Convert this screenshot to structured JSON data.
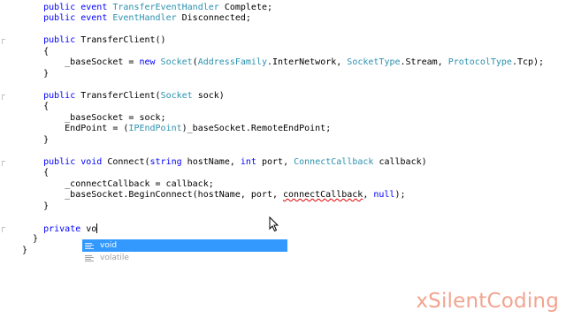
{
  "editor": {
    "lines": [
      [
        {
          "t": "    "
        },
        {
          "t": "public event ",
          "c": "kw"
        },
        {
          "t": "TransferEventHandler",
          "c": "ty"
        },
        {
          "t": " Complete;"
        }
      ],
      [
        {
          "t": "    "
        },
        {
          "t": "public event ",
          "c": "kw"
        },
        {
          "t": "EventHandler",
          "c": "ty"
        },
        {
          "t": " Disconnected;"
        }
      ],
      [
        {
          "t": ""
        }
      ],
      [
        {
          "t": "    "
        },
        {
          "t": "public ",
          "c": "kw"
        },
        {
          "t": "TransferClient()"
        }
      ],
      [
        {
          "t": "    {"
        }
      ],
      [
        {
          "t": "        _baseSocket = "
        },
        {
          "t": "new ",
          "c": "kw"
        },
        {
          "t": "Socket",
          "c": "ty"
        },
        {
          "t": "("
        },
        {
          "t": "AddressFamily",
          "c": "ty"
        },
        {
          "t": ".InterNetwork, "
        },
        {
          "t": "SocketType",
          "c": "ty"
        },
        {
          "t": ".Stream, "
        },
        {
          "t": "ProtocolType",
          "c": "ty"
        },
        {
          "t": ".Tcp);"
        }
      ],
      [
        {
          "t": "    }"
        }
      ],
      [
        {
          "t": ""
        }
      ],
      [
        {
          "t": "    "
        },
        {
          "t": "public ",
          "c": "kw"
        },
        {
          "t": "TransferClient("
        },
        {
          "t": "Socket",
          "c": "ty"
        },
        {
          "t": " sock)"
        }
      ],
      [
        {
          "t": "    {"
        }
      ],
      [
        {
          "t": "        _baseSocket = sock;"
        }
      ],
      [
        {
          "t": "        EndPoint = ("
        },
        {
          "t": "IPEndPoint",
          "c": "ty"
        },
        {
          "t": ")_baseSocket.RemoteEndPoint;"
        }
      ],
      [
        {
          "t": "    }"
        }
      ],
      [
        {
          "t": ""
        }
      ],
      [
        {
          "t": "    "
        },
        {
          "t": "public void ",
          "c": "kw"
        },
        {
          "t": "Connect("
        },
        {
          "t": "string ",
          "c": "kw"
        },
        {
          "t": "hostName, "
        },
        {
          "t": "int ",
          "c": "kw"
        },
        {
          "t": "port, "
        },
        {
          "t": "ConnectCallback",
          "c": "ty"
        },
        {
          "t": " callback)"
        }
      ],
      [
        {
          "t": "    {"
        }
      ],
      [
        {
          "t": "        _connectCallback = callback;"
        }
      ],
      [
        {
          "t": "        _baseSocket.BeginConnect(hostName, port, "
        },
        {
          "t": "connectCallback",
          "c": "sq"
        },
        {
          "t": ", "
        },
        {
          "t": "null",
          "c": "kw"
        },
        {
          "t": ");"
        }
      ],
      [
        {
          "t": "    }"
        }
      ],
      [
        {
          "t": ""
        }
      ],
      [
        {
          "t": "    "
        },
        {
          "t": "private ",
          "c": "kw"
        },
        {
          "t": "vo"
        },
        {
          "caret": true
        }
      ],
      [
        {
          "t": "  }"
        }
      ],
      [
        {
          "t": "}"
        }
      ]
    ]
  },
  "completion": {
    "items": [
      {
        "label": "void",
        "icon": "keyword-icon",
        "selected": true
      },
      {
        "label": "volatile",
        "icon": "keyword-icon",
        "selected": false
      }
    ]
  },
  "watermark": {
    "text": "xSilentCoding"
  },
  "colors": {
    "keyword": "#0000ff",
    "type": "#2b91af",
    "selection": "#3399ff",
    "watermark": "#f2a48f"
  }
}
